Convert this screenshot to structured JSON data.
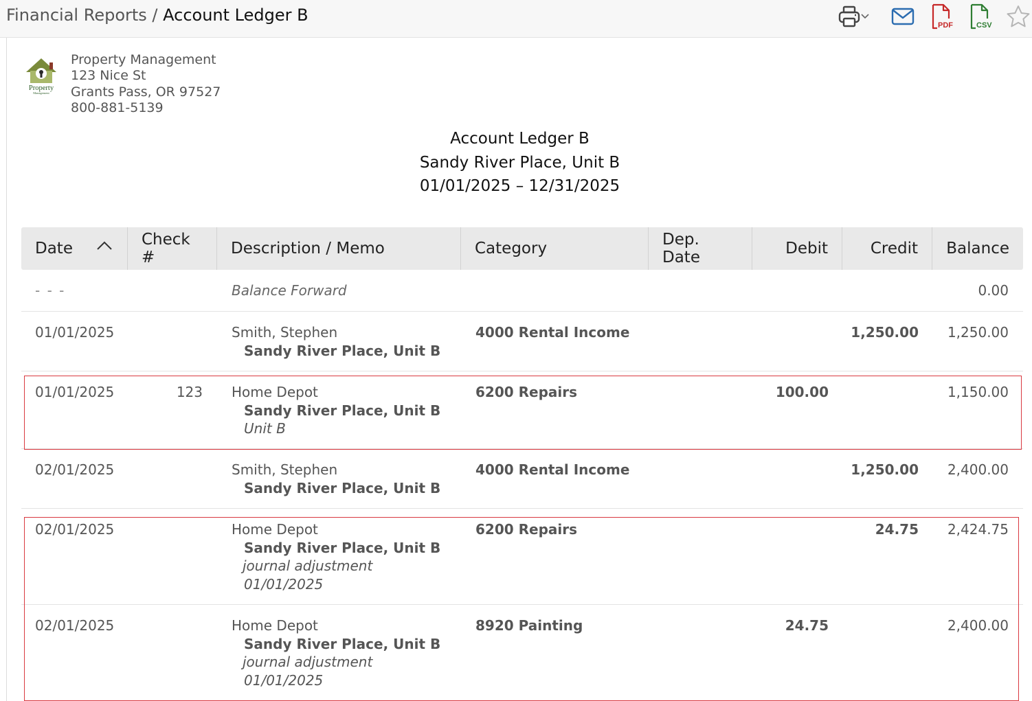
{
  "breadcrumb": {
    "parent": "Financial Reports",
    "separator": " / ",
    "current": "Account Ledger B"
  },
  "toolbar": {
    "icons": [
      "printer-icon",
      "chevron-down-icon",
      "email-icon",
      "pdf-icon",
      "csv-icon",
      "star-icon"
    ],
    "pdf_label": "PDF",
    "csv_label": "CSV",
    "colors": {
      "print": "#444444",
      "email": "#2b6cb0",
      "pdf": "#c62828",
      "csv": "#2e7d32",
      "star": "#b5b5b5"
    }
  },
  "company": {
    "logo_text": "Property",
    "logo_subtext": "Management",
    "name": "Property Management",
    "address1": "123 Nice St",
    "address2": "Grants Pass, OR 97527",
    "phone": "800-881-5139"
  },
  "report": {
    "title": "Account Ledger B",
    "property": "Sandy River Place, Unit B",
    "period": "01/01/2025 – 12/31/2025"
  },
  "table": {
    "columns": [
      "Date",
      "Check #",
      "Description / Memo",
      "Category",
      "Dep. Date",
      "Debit",
      "Credit",
      "Balance"
    ],
    "sorted_column": "Date",
    "sort_direction": "ascending",
    "rows": [
      {
        "date": "- - -",
        "check": "",
        "desc": "Balance Forward",
        "lines": [],
        "category": "",
        "dep_date": "",
        "debit": "",
        "credit": "",
        "balance": "0.00"
      },
      {
        "date": "01/01/2025",
        "check": "",
        "desc": "Smith, Stephen",
        "lines": [
          "Sandy River Place, Unit B"
        ],
        "category": "4000 Rental Income",
        "dep_date": "",
        "debit": "",
        "credit": "1,250.00",
        "balance": "1,250.00"
      },
      {
        "date": "01/01/2025",
        "check": "123",
        "desc": "Home Depot",
        "lines": [
          "Sandy River Place, Unit B",
          "Unit B"
        ],
        "category": "6200 Repairs",
        "dep_date": "",
        "debit": "100.00",
        "credit": "",
        "balance": "1,150.00"
      },
      {
        "date": "02/01/2025",
        "check": "",
        "desc": "Smith, Stephen",
        "lines": [
          "Sandy River Place, Unit B"
        ],
        "category": "4000 Rental Income",
        "dep_date": "",
        "debit": "",
        "credit": "1,250.00",
        "balance": "2,400.00"
      },
      {
        "date": "02/01/2025",
        "check": "",
        "desc": "Home Depot",
        "lines": [
          "Sandy River Place, Unit B",
          "journal adjustment",
          "01/01/2025"
        ],
        "category": "6200 Repairs",
        "dep_date": "",
        "debit": "",
        "credit": "24.75",
        "balance": "2,424.75"
      },
      {
        "date": "02/01/2025",
        "check": "",
        "desc": "Home Depot",
        "lines": [
          "Sandy River Place, Unit B",
          "journal adjustment",
          "01/01/2025"
        ],
        "category": "8920 Painting",
        "dep_date": "",
        "debit": "24.75",
        "credit": "",
        "balance": "2,400.00"
      }
    ],
    "highlight_color": "#d9383f"
  }
}
